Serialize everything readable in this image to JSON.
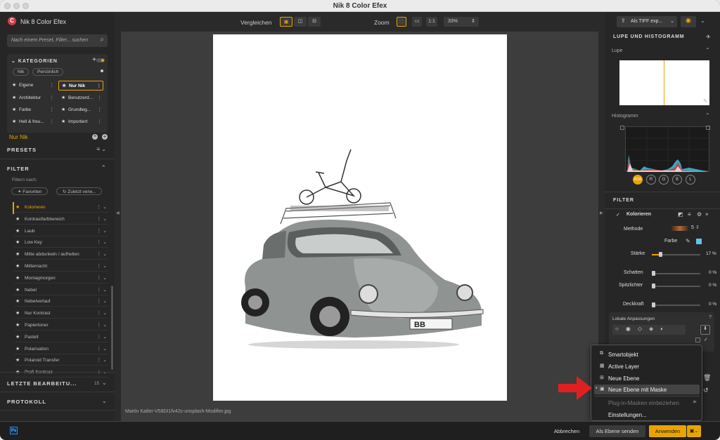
{
  "window": {
    "title": "Nik 8 Color Efex"
  },
  "app": {
    "name": "Nik 8 Color Efex",
    "logo_letter": "C"
  },
  "search": {
    "placeholder": "Nach einem Preset, Filter... suchen"
  },
  "categories": {
    "heading": "KATEGORIEN",
    "chips": [
      "Nik",
      "Persönlich"
    ],
    "cells": [
      {
        "label": "Eigene",
        "selected": false
      },
      {
        "label": "Nur Nik",
        "selected": true
      },
      {
        "label": "Architektur",
        "selected": false
      },
      {
        "label": "Benutzerd...",
        "selected": false
      },
      {
        "label": "Farbe",
        "selected": false
      },
      {
        "label": "Grundleg...",
        "selected": false
      },
      {
        "label": "Hell & freu...",
        "selected": false
      },
      {
        "label": "Importiert",
        "selected": false
      }
    ],
    "current": "Nur Nik"
  },
  "presets": {
    "heading": "PRESETS"
  },
  "filter_left": {
    "heading": "FILTER",
    "filter_by": "Filtern nach:",
    "favorites": "Favoriten",
    "recent": "Zuletzt verw...",
    "items": [
      "Kolorieren",
      "Kontrastfarbbereich",
      "Laub",
      "Low Key",
      "Mitte abdunkeln / aufhellen",
      "Mitternacht",
      "Montagmorgen",
      "Nebel",
      "Nebelverlauf",
      "Nur Kontrast",
      "Papiertoner",
      "Pastell",
      "Polarisation",
      "Polaroid Transfer",
      "Profi-Kontrast"
    ],
    "highlighted": "Kolorieren"
  },
  "recent_edits": {
    "heading": "LETZTE BEARBEITU...",
    "count": "15"
  },
  "protocol": {
    "heading": "PROTOKOLL"
  },
  "toolbar": {
    "compare_label": "Vergleichen",
    "zoom_label": "Zoom",
    "zoom_1to1": "1:1",
    "zoom_value": "33%"
  },
  "canvas": {
    "plate": "BB",
    "filename": "Martin Katler-V58DI1fv42c-unsplash-Modifier.jpg"
  },
  "right": {
    "export_label": "Als TIFF exp...",
    "loupe_heading": "LUPE UND HISTOGRAMM",
    "loupe_label": "Lupe",
    "histogram_label": "Histogramm",
    "hist_channels": [
      "RGB",
      "R",
      "G",
      "B",
      "L"
    ],
    "filter_heading": "FILTER",
    "filter_name": "Kolorieren",
    "method_label": "Methode",
    "method_value": "5",
    "color_label": "Farbe",
    "color_swatch": "#5ec4e8",
    "strength_label": "Stärke",
    "strength_value": "17 %",
    "strength_level": 17,
    "shadows_label": "Schatten",
    "shadows_value": "0 %",
    "highlights_label": "Spitzlichter",
    "highlights_value": "0 %",
    "opacity_label": "Deckkraft",
    "opacity_value": "0 %",
    "local_label": "Lokale Anpassungen"
  },
  "menu": {
    "items": [
      {
        "label": "Smartobjekt",
        "state": "normal"
      },
      {
        "label": "Active Layer",
        "state": "normal"
      },
      {
        "label": "Neue Ebene",
        "state": "normal"
      },
      {
        "label": "Neue Ebene mit Maske",
        "state": "selected"
      },
      {
        "label": "Plug-in-Masken einbeziehen",
        "state": "disabled"
      },
      {
        "label": "Einstellungen...",
        "state": "normal"
      }
    ]
  },
  "bottom": {
    "ps_label": "Ps",
    "cancel": "Abbrechen",
    "send_as_layer": "Als Ebene senden",
    "apply": "Anwenden"
  },
  "colors": {
    "accent": "#e9a400",
    "arrow": "#e02020",
    "logo": "#d23b4b"
  }
}
